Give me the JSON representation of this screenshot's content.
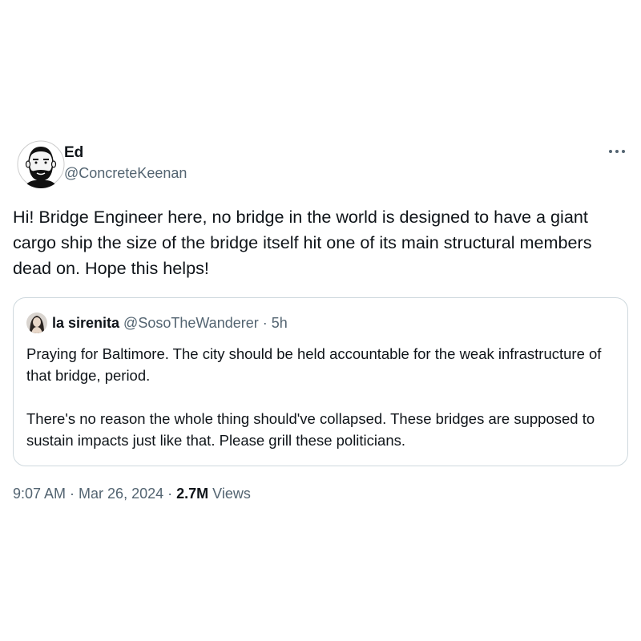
{
  "tweet": {
    "author_name": "Ed",
    "author_handle": "@ConcreteKeenan",
    "more_icon": "more-horizontal-icon",
    "text": "Hi! Bridge Engineer here, no bridge in the world is designed to have a giant cargo ship the size of the bridge itself hit one of its main structural members dead on. Hope this helps!",
    "time": "9:07 AM",
    "date": "Mar 26, 2024",
    "views_count": "2.7M",
    "views_label": "Views",
    "separator": "·"
  },
  "quoted_tweet": {
    "author_name": "la sirenita",
    "author_handle": "@SosoTheWanderer",
    "separator": "·",
    "time_ago": "5h",
    "paragraph_1": "Praying for Baltimore. The city should be held accountable for the weak infrastructure of that bridge, period.",
    "paragraph_2": "There's no reason the whole thing should've collapsed. These bridges are supposed to sustain impacts just like that. Please grill these politicians."
  },
  "colors": {
    "text_primary": "#0f1419",
    "text_secondary": "#536471",
    "border": "#cfd9de",
    "background": "#ffffff"
  }
}
